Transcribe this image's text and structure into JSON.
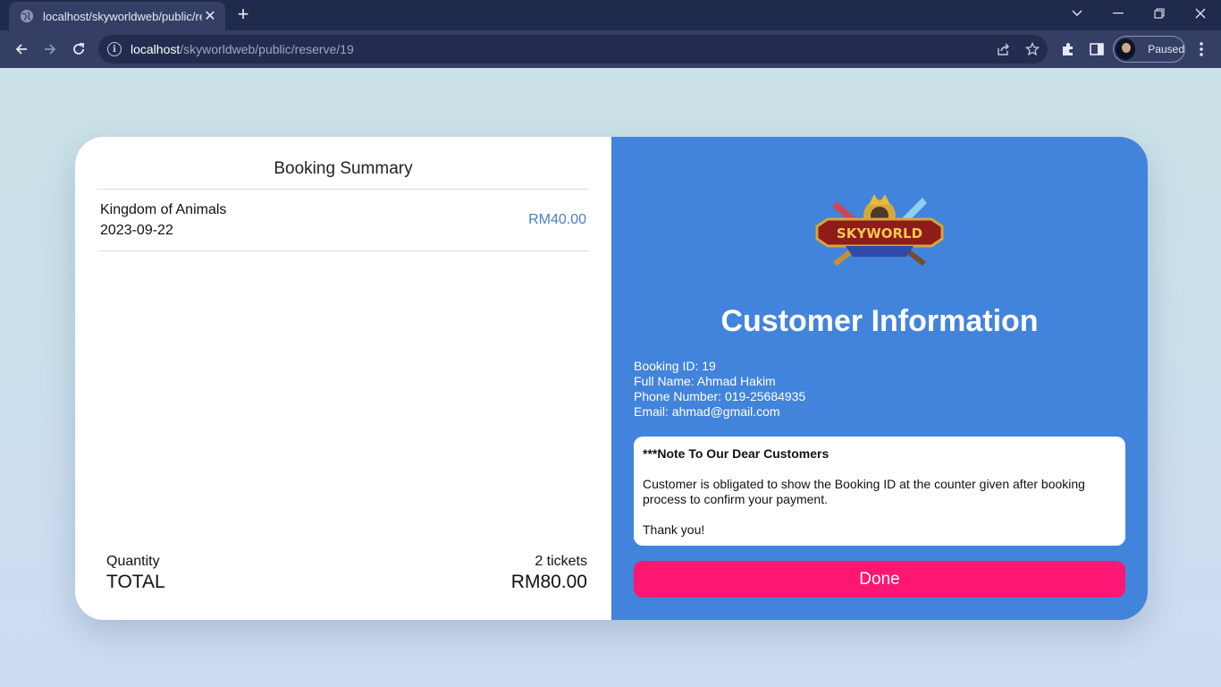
{
  "browser": {
    "tab_title": "localhost/skyworldweb/public/reserve/19",
    "url_host": "localhost",
    "url_path": "/skyworldweb/public/reserve/19",
    "profile_status": "Paused"
  },
  "summary": {
    "title": "Booking Summary",
    "item": {
      "name": "Kingdom of Animals",
      "date": "2023-09-22",
      "price": "RM40.00"
    },
    "quantity_label": "Quantity",
    "quantity_value": "2 tickets",
    "total_label": "TOTAL",
    "total_value": "RM80.00"
  },
  "customer": {
    "logo_text": "SKYWORLD",
    "title": "Customer Information",
    "lines": [
      "Booking ID: 19",
      "Full Name: Ahmad Hakim",
      "Phone Number: 019-25684935",
      "Email: ahmad@gmail.com"
    ],
    "note": {
      "title": "***Note To Our Dear Customers",
      "body": "Customer is obligated to show the Booking ID at the counter given after booking process to confirm your payment.",
      "closing": "Thank you!"
    },
    "done_label": "Done"
  },
  "colors": {
    "accent_blue": "#4284db",
    "done_pink": "#fd1773",
    "price_blue": "#4a7fc8"
  }
}
